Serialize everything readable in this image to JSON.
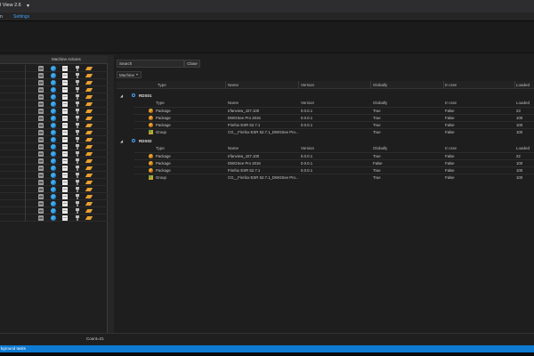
{
  "window": {
    "title": "l View 2.6"
  },
  "menu": {
    "items": [
      "n",
      "Settings"
    ]
  },
  "left_pane": {
    "columns": [
      "",
      "Machine Actions"
    ],
    "row_count": 22,
    "icons": [
      "computer-icon",
      "globe-icon",
      "document-icon",
      "network-icon",
      "lightning-icon"
    ]
  },
  "search": {
    "label": "Search",
    "close_label": "Close"
  },
  "groupby": {
    "value": "Machine"
  },
  "grid": {
    "columns": [
      "Type",
      "Name",
      "Version",
      "Globally",
      "In Use",
      "Loaded"
    ],
    "groups": [
      {
        "name": "RDS01",
        "rows": [
          {
            "type": "Package",
            "name": "Irfanview_427.100",
            "version": "0.0.0.1",
            "globally": "True",
            "in_use": "False",
            "loaded": "23"
          },
          {
            "type": "Package",
            "name": "DWGSee Pro 2016",
            "version": "0.0.0.1",
            "globally": "True",
            "in_use": "False",
            "loaded": "100"
          },
          {
            "type": "Package",
            "name": "Firefox ESR 52.7.1",
            "version": "0.0.0.1",
            "globally": "True",
            "in_use": "False",
            "loaded": "100"
          },
          {
            "type": "Group",
            "name": "CG__Firefox ESR 52.7.1_DWGSee Pro...",
            "version": "",
            "globally": "True",
            "in_use": "False",
            "loaded": "100"
          }
        ]
      },
      {
        "name": "RDS02",
        "rows": [
          {
            "type": "Package",
            "name": "Irfanview_427.100",
            "version": "0.0.0.1",
            "globally": "True",
            "in_use": "False",
            "loaded": "22"
          },
          {
            "type": "Package",
            "name": "DWGSee Pro 2016",
            "version": "0.0.0.1",
            "globally": "False",
            "in_use": "False",
            "loaded": "100"
          },
          {
            "type": "Package",
            "name": "Firefox ESR 52.7.1",
            "version": "0.0.0.1",
            "globally": "True",
            "in_use": "False",
            "loaded": "100"
          },
          {
            "type": "Group",
            "name": "CG__Firefox ESR 52.7.1_DWGSee Pro...",
            "version": "",
            "globally": "True",
            "in_use": "False",
            "loaded": "100"
          }
        ]
      }
    ]
  },
  "status": {
    "count": "Count=21",
    "background": "kground tasks"
  },
  "colors": {
    "accent": "#0e7ad2",
    "link": "#3ea1f5",
    "package_icon": "#e8a030",
    "globe_icon": "#3fa9e8"
  }
}
